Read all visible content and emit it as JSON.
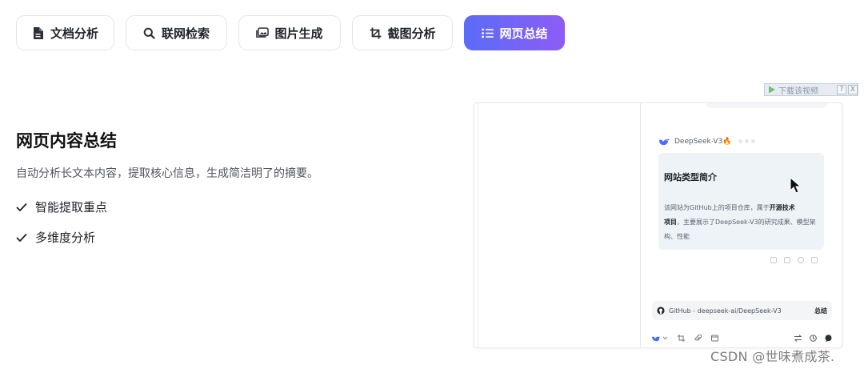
{
  "tabs": [
    {
      "label": "文档分析",
      "icon": "document-icon",
      "active": false
    },
    {
      "label": "联网检索",
      "icon": "search-icon",
      "active": false
    },
    {
      "label": "图片生成",
      "icon": "image-icon",
      "active": false
    },
    {
      "label": "截图分析",
      "icon": "crop-icon",
      "active": false
    },
    {
      "label": "网页总结",
      "icon": "list-icon",
      "active": true
    }
  ],
  "feature": {
    "title": "网页内容总结",
    "description": "自动分析长文本内容，提取核心信息，生成简洁明了的摘要。",
    "bullets": [
      "智能提取重点",
      "多维度分析"
    ]
  },
  "download_bar": {
    "label": "下载该视频",
    "help": "?",
    "close": "X"
  },
  "preview": {
    "model_name": "DeepSeek-V3🔥",
    "card_title": "网站类型简介",
    "card_text_1": "该网站为GitHub上的项目仓库，属于",
    "card_text_bold_1": "开源技术",
    "card_text_bold_2": "项目",
    "card_text_2": "，主要展示了DeepSeek-V3的研究成果、模型架构、性能",
    "link_title": "GitHub - deepseek-ai/DeepSeek-V3",
    "link_action": "总结"
  },
  "watermark": "CSDN @世味煮成茶.",
  "colors": {
    "accent_start": "#5b6cf6",
    "accent_end": "#8d5cf6"
  }
}
